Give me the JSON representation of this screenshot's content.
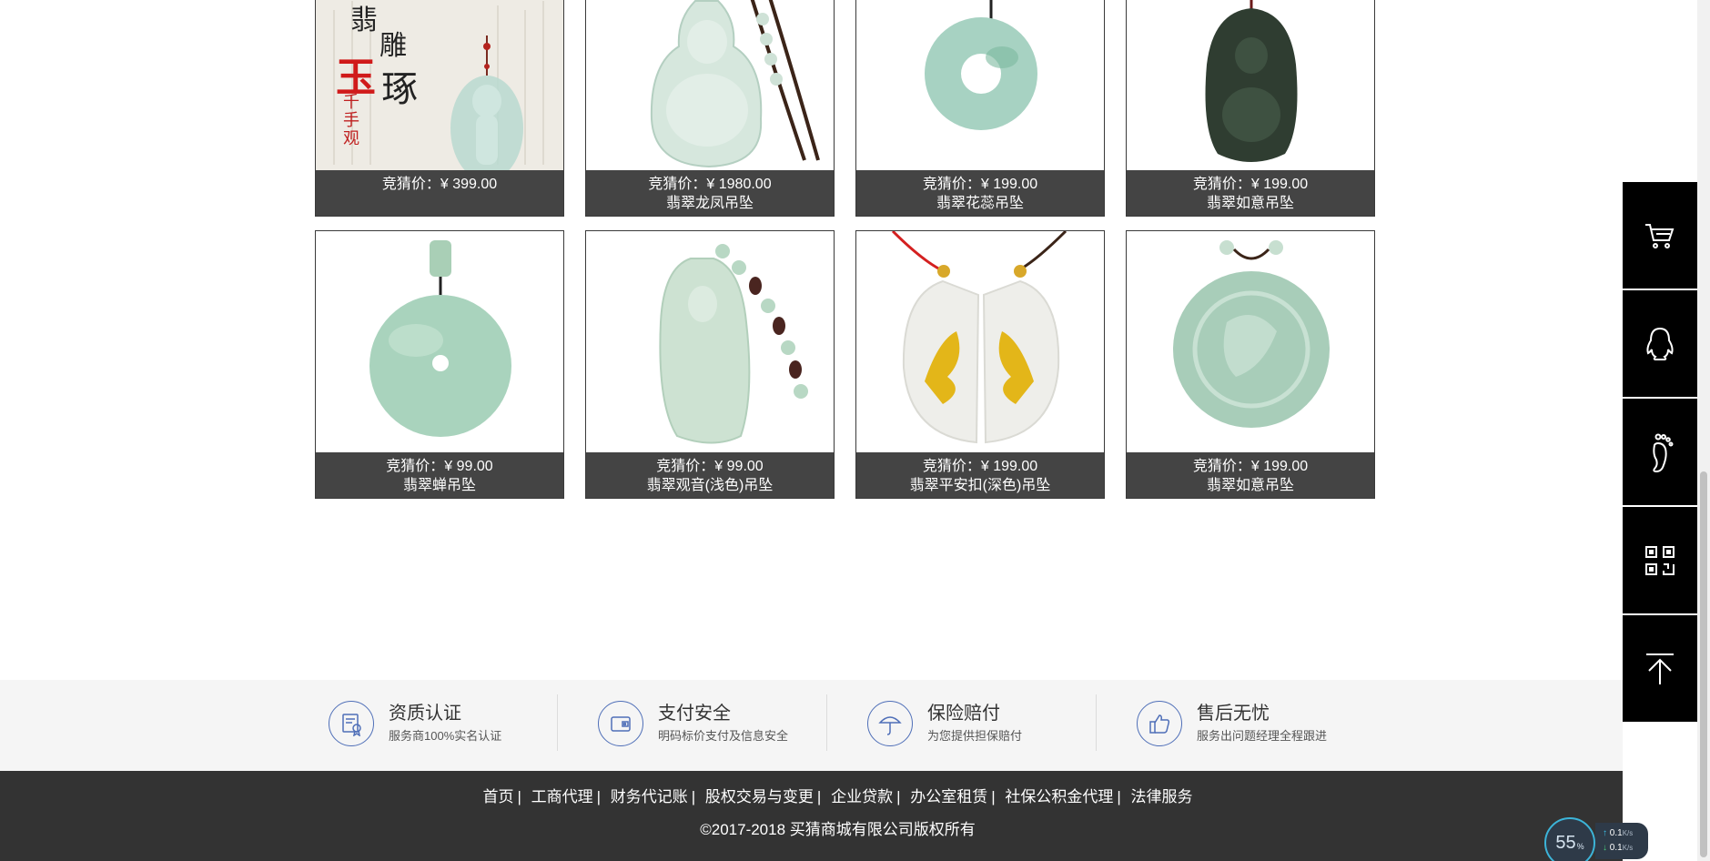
{
  "products": [
    {
      "price_label": "竞猜价：¥ 399.00",
      "name": "",
      "image": "jade-guanyin-poster"
    },
    {
      "price_label": "竞猜价：¥ 1980.00",
      "name": "翡翠龙凤吊坠",
      "image": "jade-buddha-pendant"
    },
    {
      "price_label": "竞猜价：¥ 199.00",
      "name": "翡翠花蕊吊坠",
      "image": "jade-donut-ring"
    },
    {
      "price_label": "竞猜价：¥ 199.00",
      "name": "翡翠如意吊坠",
      "image": "dark-jade-deity-pendant"
    },
    {
      "price_label": "竞猜价：¥ 99.00",
      "name": "翡翠蝉吊坠",
      "image": "jade-disc-pendant"
    },
    {
      "price_label": "竞猜价：¥ 99.00",
      "name": "翡翠观音(浅色)吊坠",
      "image": "jade-guanyin-pendant"
    },
    {
      "price_label": "竞猜价：¥ 199.00",
      "name": "翡翠平安扣(深色)吊坠",
      "image": "jade-gold-couple-pendant"
    },
    {
      "price_label": "竞猜价：¥ 199.00",
      "name": "翡翠如意吊坠",
      "image": "jade-dragon-medallion"
    }
  ],
  "poster_text": {
    "line1": "翡",
    "line2": "雕",
    "line3": "玉",
    "line4": "琢",
    "vertical": "千手观"
  },
  "guarantees": [
    {
      "title": "资质认证",
      "subtitle": "服务商100%实名认证",
      "icon": "certificate-icon"
    },
    {
      "title": "支付安全",
      "subtitle": "明码标价支付及信息安全",
      "icon": "wallet-icon"
    },
    {
      "title": "保险赔付",
      "subtitle": "为您提供担保赔付",
      "icon": "umbrella-icon"
    },
    {
      "title": "售后无忧",
      "subtitle": "服务出问题经理全程跟进",
      "icon": "thumbs-up-icon"
    }
  ],
  "footer": {
    "links": [
      "首页",
      "工商代理",
      "财务代记账",
      "股权交易与变更",
      "企业贷款",
      "办公室租赁",
      "社保公积金代理",
      "法律服务"
    ],
    "copyright": "©2017-2018  买猜商城有限公司版权所有"
  },
  "sidebar": [
    {
      "icon": "cart-icon"
    },
    {
      "icon": "qq-penguin-icon"
    },
    {
      "icon": "footprint-icon"
    },
    {
      "icon": "qr-code-icon"
    },
    {
      "icon": "back-to-top-icon"
    }
  ],
  "speed_widget": {
    "percent": "55",
    "percent_unit": "%",
    "upload": "0.1",
    "download": "0.1",
    "unit": "K/s"
  },
  "colors": {
    "caption_bg": "#444444",
    "footer_bg": "#333333",
    "strip_bg": "#f5f5f5",
    "icon_blue": "#4f6fb8",
    "sidebar_bg": "#000000"
  }
}
